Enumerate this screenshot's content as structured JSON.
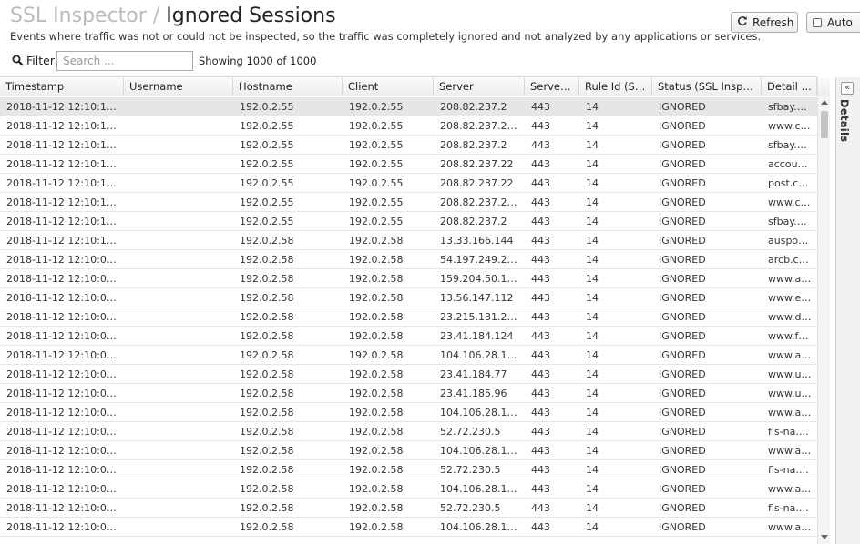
{
  "header": {
    "app_title": "SSL Inspector",
    "separator": "/",
    "page_title": "Ignored Sessions",
    "description": "Events where traffic was not or could not be inspected, so the traffic was completely ignored and not analyzed by any applications or services."
  },
  "toolbar": {
    "refresh_label": "Refresh",
    "auto_label": "Auto",
    "refresh_icon": "refresh-icon"
  },
  "filter": {
    "label": "Filter",
    "placeholder": "Search ...",
    "showing": "Showing 1000 of 1000"
  },
  "side_panel": {
    "label": "Details",
    "collapse_glyph": "«"
  },
  "table": {
    "columns": [
      "Timestamp",
      "Username",
      "Hostname",
      "Client",
      "Server",
      "Serve…",
      "Rule Id (S…",
      "Status (SSL Insp…",
      "Detail …"
    ],
    "rows": [
      [
        "2018-11-12 12:10:1…",
        "",
        "192.0.2.55",
        "192.0.2.55",
        "208.82.237.2",
        "443",
        "14",
        "IGNORED",
        "sfbay.…"
      ],
      [
        "2018-11-12 12:10:1…",
        "",
        "192.0.2.55",
        "192.0.2.55",
        "208.82.237.2…",
        "443",
        "14",
        "IGNORED",
        "www.c…"
      ],
      [
        "2018-11-12 12:10:1…",
        "",
        "192.0.2.55",
        "192.0.2.55",
        "208.82.237.2",
        "443",
        "14",
        "IGNORED",
        "sfbay.…"
      ],
      [
        "2018-11-12 12:10:1…",
        "",
        "192.0.2.55",
        "192.0.2.55",
        "208.82.237.22",
        "443",
        "14",
        "IGNORED",
        "accou…"
      ],
      [
        "2018-11-12 12:10:1…",
        "",
        "192.0.2.55",
        "192.0.2.55",
        "208.82.237.22",
        "443",
        "14",
        "IGNORED",
        "post.c…"
      ],
      [
        "2018-11-12 12:10:1…",
        "",
        "192.0.2.55",
        "192.0.2.55",
        "208.82.237.2…",
        "443",
        "14",
        "IGNORED",
        "www.c…"
      ],
      [
        "2018-11-12 12:10:1…",
        "",
        "192.0.2.55",
        "192.0.2.55",
        "208.82.237.2",
        "443",
        "14",
        "IGNORED",
        "sfbay.…"
      ],
      [
        "2018-11-12 12:10:1…",
        "",
        "192.0.2.58",
        "192.0.2.58",
        "13.33.166.144",
        "443",
        "14",
        "IGNORED",
        "auspo…"
      ],
      [
        "2018-11-12 12:10:0…",
        "",
        "192.0.2.58",
        "192.0.2.58",
        "54.197.249.2…",
        "443",
        "14",
        "IGNORED",
        "arcb.c…"
      ],
      [
        "2018-11-12 12:10:0…",
        "",
        "192.0.2.58",
        "192.0.2.58",
        "159.204.50.1…",
        "443",
        "14",
        "IGNORED",
        "www.a…"
      ],
      [
        "2018-11-12 12:10:0…",
        "",
        "192.0.2.58",
        "192.0.2.58",
        "13.56.147.112",
        "443",
        "14",
        "IGNORED",
        "www.e…"
      ],
      [
        "2018-11-12 12:10:0…",
        "",
        "192.0.2.58",
        "192.0.2.58",
        "23.215.131.2…",
        "443",
        "14",
        "IGNORED",
        "www.d…"
      ],
      [
        "2018-11-12 12:10:0…",
        "",
        "192.0.2.58",
        "192.0.2.58",
        "23.41.184.124",
        "443",
        "14",
        "IGNORED",
        "www.f…"
      ],
      [
        "2018-11-12 12:10:0…",
        "",
        "192.0.2.58",
        "192.0.2.58",
        "104.106.28.1…",
        "443",
        "14",
        "IGNORED",
        "www.a…"
      ],
      [
        "2018-11-12 12:10:0…",
        "",
        "192.0.2.58",
        "192.0.2.58",
        "23.41.184.77",
        "443",
        "14",
        "IGNORED",
        "www.u…"
      ],
      [
        "2018-11-12 12:10:0…",
        "",
        "192.0.2.58",
        "192.0.2.58",
        "23.41.185.96",
        "443",
        "14",
        "IGNORED",
        "www.u…"
      ],
      [
        "2018-11-12 12:10:0…",
        "",
        "192.0.2.58",
        "192.0.2.58",
        "104.106.28.1…",
        "443",
        "14",
        "IGNORED",
        "www.a…"
      ],
      [
        "2018-11-12 12:10:0…",
        "",
        "192.0.2.58",
        "192.0.2.58",
        "52.72.230.5",
        "443",
        "14",
        "IGNORED",
        "fls-na.…"
      ],
      [
        "2018-11-12 12:10:0…",
        "",
        "192.0.2.58",
        "192.0.2.58",
        "104.106.28.1…",
        "443",
        "14",
        "IGNORED",
        "www.a…"
      ],
      [
        "2018-11-12 12:10:0…",
        "",
        "192.0.2.58",
        "192.0.2.58",
        "52.72.230.5",
        "443",
        "14",
        "IGNORED",
        "fls-na.…"
      ],
      [
        "2018-11-12 12:10:0…",
        "",
        "192.0.2.58",
        "192.0.2.58",
        "104.106.28.1…",
        "443",
        "14",
        "IGNORED",
        "www.a…"
      ],
      [
        "2018-11-12 12:10:0…",
        "",
        "192.0.2.58",
        "192.0.2.58",
        "52.72.230.5",
        "443",
        "14",
        "IGNORED",
        "fls-na.…"
      ],
      [
        "2018-11-12 12:10:0…",
        "",
        "192.0.2.58",
        "192.0.2.58",
        "104.106.28.1…",
        "443",
        "14",
        "IGNORED",
        "www.a…"
      ]
    ],
    "selected_row": 0
  }
}
